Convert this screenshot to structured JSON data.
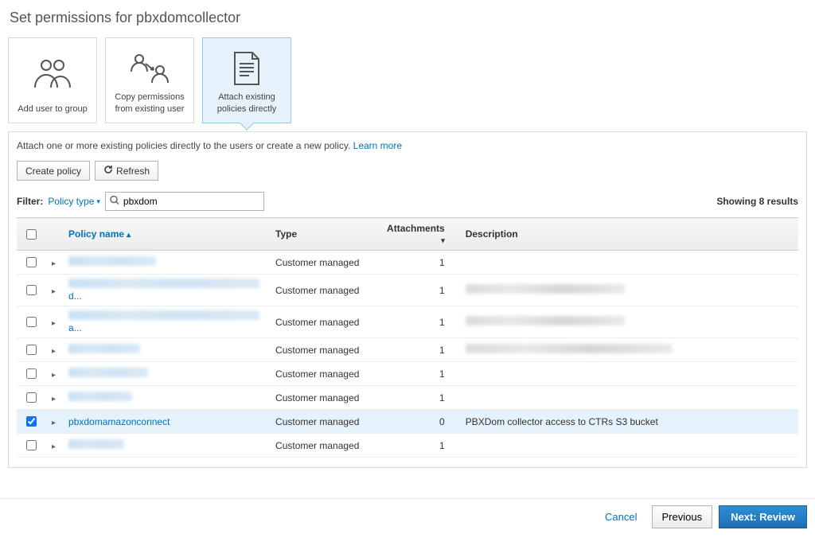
{
  "page_title": "Set permissions for pbxdomcollector",
  "cards": {
    "add_user": "Add user to group",
    "copy_perms": "Copy permissions from existing user",
    "attach_policies": "Attach existing policies directly"
  },
  "help": {
    "text": "Attach one or more existing policies directly to the users or create a new policy.",
    "learn_more": "Learn more"
  },
  "toolbar": {
    "create_policy": "Create policy",
    "refresh": "Refresh"
  },
  "filter": {
    "label": "Filter:",
    "type": "Policy type",
    "search_value": "pbxdom",
    "results": "Showing 8 results"
  },
  "columns": {
    "name": "Policy name",
    "type": "Type",
    "attachments": "Attachments",
    "description": "Description"
  },
  "rows": [
    {
      "checked": false,
      "name_blur_w": 110,
      "name_text": null,
      "name_suffix": null,
      "type": "Customer managed",
      "attachments": "1",
      "desc_text": null,
      "desc_blur_w": 0
    },
    {
      "checked": false,
      "name_blur_w": 240,
      "name_text": null,
      "name_suffix": "d...",
      "type": "Customer managed",
      "attachments": "1",
      "desc_text": null,
      "desc_blur_w": 200
    },
    {
      "checked": false,
      "name_blur_w": 240,
      "name_text": null,
      "name_suffix": "a...",
      "type": "Customer managed",
      "attachments": "1",
      "desc_text": null,
      "desc_blur_w": 200
    },
    {
      "checked": false,
      "name_blur_w": 90,
      "name_text": null,
      "name_suffix": null,
      "type": "Customer managed",
      "attachments": "1",
      "desc_text": null,
      "desc_blur_w": 260
    },
    {
      "checked": false,
      "name_blur_w": 100,
      "name_text": null,
      "name_suffix": null,
      "type": "Customer managed",
      "attachments": "1",
      "desc_text": null,
      "desc_blur_w": 0
    },
    {
      "checked": false,
      "name_blur_w": 80,
      "name_text": null,
      "name_suffix": null,
      "type": "Customer managed",
      "attachments": "1",
      "desc_text": null,
      "desc_blur_w": 0
    },
    {
      "checked": true,
      "name_blur_w": 0,
      "name_text": "pbxdomamazonconnect",
      "name_suffix": null,
      "type": "Customer managed",
      "attachments": "0",
      "desc_text": "PBXDom collector access to CTRs S3 bucket",
      "desc_blur_w": 0
    },
    {
      "checked": false,
      "name_blur_w": 70,
      "name_text": null,
      "name_suffix": null,
      "type": "Customer managed",
      "attachments": "1",
      "desc_text": null,
      "desc_blur_w": 0
    }
  ],
  "footer": {
    "cancel": "Cancel",
    "previous": "Previous",
    "next": "Next: Review"
  }
}
